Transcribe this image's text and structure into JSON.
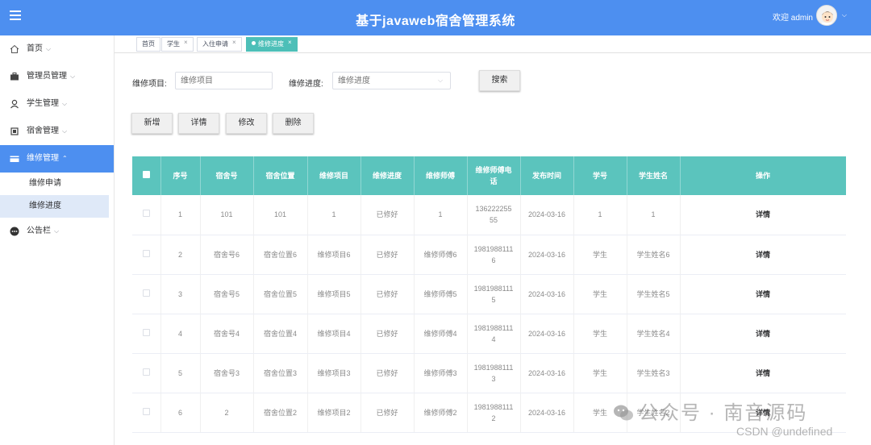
{
  "header": {
    "title": "基于javaweb宿舍管理系统",
    "welcome": "欢迎 admin"
  },
  "sidebar": {
    "items": [
      {
        "label": "首页",
        "icon": "home-icon"
      },
      {
        "label": "管理员管理",
        "icon": "briefcase-icon"
      },
      {
        "label": "学生管理",
        "icon": "user-icon"
      },
      {
        "label": "宿舍管理",
        "icon": "chip-icon"
      },
      {
        "label": "维修管理",
        "icon": "card-icon"
      },
      {
        "label": "公告栏",
        "icon": "more-icon"
      }
    ],
    "subitems": [
      "维修申请",
      "维修进度"
    ]
  },
  "tabs": [
    {
      "label": "首页"
    },
    {
      "label": "学生"
    },
    {
      "label": "入住申请"
    },
    {
      "label": "维修进度"
    }
  ],
  "search": {
    "item_label": "维修项目:",
    "item_placeholder": "维修项目",
    "progress_label": "维修进度:",
    "progress_placeholder": "维修进度",
    "search_button": "搜索"
  },
  "actions": {
    "add": "新增",
    "detail": "详情",
    "edit": "修改",
    "delete": "删除"
  },
  "table": {
    "headers": [
      "序号",
      "宿舍号",
      "宿舍位置",
      "维修项目",
      "维修进度",
      "维修师傅",
      "维修师傅电话",
      "发布时间",
      "学号",
      "学生姓名",
      "操作"
    ],
    "op_label": "详情",
    "rows": [
      [
        "1",
        "101",
        "101",
        "1",
        "已修好",
        "1",
        "13622225555",
        "2024-03-16",
        "1",
        "1"
      ],
      [
        "2",
        "宿舍号6",
        "宿舍位置6",
        "维修项目6",
        "已修好",
        "维修师傅6",
        "19819881116",
        "2024-03-16",
        "学生",
        "学生姓名6"
      ],
      [
        "3",
        "宿舍号5",
        "宿舍位置5",
        "维修项目5",
        "已修好",
        "维修师傅5",
        "19819881115",
        "2024-03-16",
        "学生",
        "学生姓名5"
      ],
      [
        "4",
        "宿舍号4",
        "宿舍位置4",
        "维修项目4",
        "已修好",
        "维修师傅4",
        "19819881114",
        "2024-03-16",
        "学生",
        "学生姓名4"
      ],
      [
        "5",
        "宿舍号3",
        "宿舍位置3",
        "维修项目3",
        "已修好",
        "维修师傅3",
        "19819881113",
        "2024-03-16",
        "学生",
        "学生姓名3"
      ],
      [
        "6",
        "2",
        "宿舍位置2",
        "维修项目2",
        "已修好",
        "维修师傅2",
        "19819881112",
        "2024-03-16",
        "学生",
        "学生姓名2"
      ]
    ]
  },
  "watermark": {
    "wechat": "公众号 · 南音源码",
    "csdn": "CSDN @undefined"
  },
  "colors": {
    "header": "#4d8ff0",
    "table_header": "#5bc4bd",
    "active_tab": "#4dbfb8"
  }
}
